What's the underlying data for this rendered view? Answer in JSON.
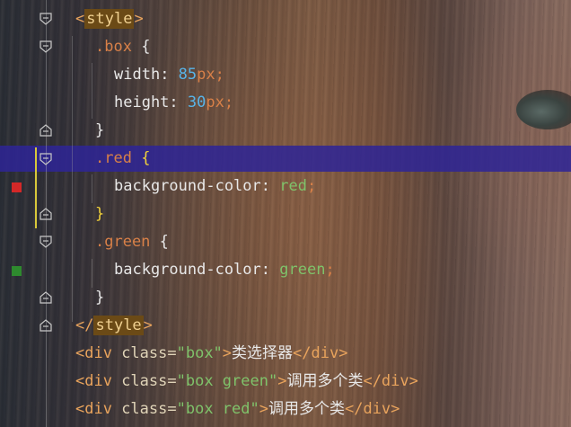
{
  "colors": {
    "highlight_row": "#2e2496",
    "red_marker": "#d42828",
    "green_marker": "#2e8a2e"
  },
  "icons": [
    "fold-open-icon",
    "fold-close-icon",
    "color-swatch-icon"
  ],
  "code": {
    "style_open": {
      "lt": "<",
      "name": "style",
      "gt": ">"
    },
    "box_selector": ".box",
    "box_open_brace": "{",
    "width_prop": "width",
    "width_colon": ": ",
    "width_num": "85",
    "width_unit": "px",
    "width_semi": ";",
    "height_prop": "height",
    "height_colon": ": ",
    "height_num": "30",
    "height_unit": "px",
    "height_semi": ";",
    "box_close_brace": "}",
    "red_selector": ".red",
    "red_open_brace": "{",
    "red_bg_prop": "background-color",
    "red_bg_colon": ": ",
    "red_bg_value": "red",
    "red_bg_semi": ";",
    "red_close_brace": "}",
    "green_selector": ".green",
    "green_open_brace": "{",
    "green_bg_prop": "background-color",
    "green_bg_colon": ": ",
    "green_bg_value": "green",
    "green_bg_semi": ";",
    "green_close_brace": "}",
    "style_close": {
      "lt": "</",
      "name": "style",
      "gt": ">"
    },
    "div1": {
      "open": "<div",
      "attr": " class=",
      "value": "\"box\"",
      "gt": ">",
      "text": "类选择器",
      "close": "</div>"
    },
    "div2": {
      "open": "<div",
      "attr": " class=",
      "value": "\"box green\"",
      "gt": ">",
      "text": "调用多个类",
      "close": "</div>"
    },
    "div3": {
      "open": "<div",
      "attr": " class=",
      "value": "\"box red\"",
      "gt": ">",
      "text": "调用多个类",
      "close": "</div>"
    }
  }
}
